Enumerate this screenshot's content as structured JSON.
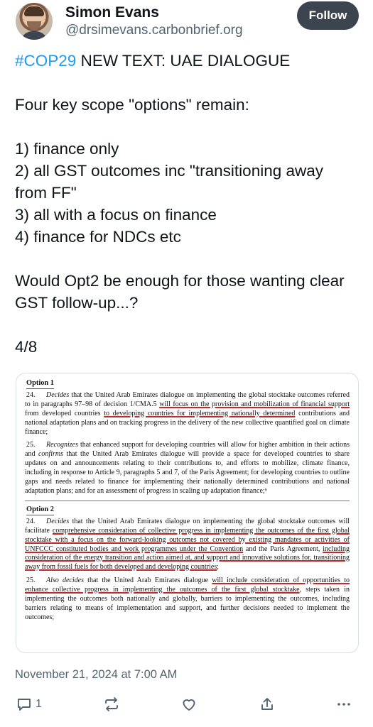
{
  "author": {
    "name": "Simon Evans",
    "handle": "@drsimevans.carbonbrief.org",
    "follow_label": "Follow"
  },
  "post": {
    "hashtag": "#COP29",
    "text_after_hashtag": " NEW TEXT: UAE DIALOGUE\n\nFour key scope \"options\" remain:\n\n1) finance only\n2) all GST outcomes inc \"transitioning away from FF\"\n3) all with a focus on finance\n4) finance for NDCs etc\n\nWould Opt2 be enough for those wanting clear GST follow-up...?\n\n4/8"
  },
  "document": {
    "option1": {
      "heading": "Option 1",
      "p24": {
        "num": "24.",
        "verb": "Decides",
        "pre": " that the United Arab Emirates dialogue on implementing the global stocktake outcomes referred to in paragraphs 97–98 of decision 1/CMA.5 ",
        "underlined": "will focus on the provision and mobilization of financial support",
        "mid": " from developed countries ",
        "underlined2": "to developing countries for implementing nationally determined",
        "post": " contributions and national adaptation plans and on tracking progress in the delivery of the new collective quantified goal on climate finance;"
      },
      "p25": {
        "num": "25.",
        "verb": "Recognizes",
        "pre": " that enhanced support for developing countries will allow for higher ambition in their actions and ",
        "verb2": "confirms",
        "post": " that the United Arab Emirates dialogue will provide a space for developed countries to share updates on and announcements relating to their contributions to, and efforts to mobilize, climate finance, including in response to Article 9, paragraphs 5 and 7, of the Paris Agreement; for developing countries to outline gaps and needs related to finance for implementing their nationally determined contributions and national adaptation plans; and for an assessment of progress in scaling up adaptation finance;⁶"
      }
    },
    "option2": {
      "heading": "Option 2",
      "p24": {
        "num": "24.",
        "verb": "Decides",
        "pre": " that the United Arab Emirates dialogue on implementing the global stocktake outcomes will facilitate ",
        "underlined": "comprehensive consideration of collective progress in implementing the outcomes of the first global stocktake with a focus on the forward-looking outcomes not covered by existing mandates or activities of UNFCCC constituted bodies and work programmes under the Convention",
        "mid": " and the Paris Agreement, ",
        "underlined2": "including consideration of the energy transition and action aimed at, and support and innovative solutions for, transitioning away from fossil fuels for both developed and developing countries",
        "post": ";"
      },
      "p25": {
        "num": "25.",
        "verb": "Also decides",
        "pre": " that the United Arab Emirates dialogue ",
        "underlined": "will include consideration of opportunities to enhance collective progress in implementing the outcomes of the first global stocktake",
        "post": ", steps taken in implementing the outcomes both nationally and globally, barriers to implementing the outcomes, including barriers relating to means of implementation and support, and further decisions needed to implement the outcomes;"
      }
    }
  },
  "timestamp": "November 21, 2024 at 7:00 AM",
  "actions": {
    "reply_count": "1",
    "reply_icon": "reply-icon",
    "repost_icon": "repost-icon",
    "like_icon": "like-icon",
    "share_icon": "share-icon",
    "more_icon": "more-icon"
  },
  "colors": {
    "hashtag": "#1d9bf0",
    "follow_button": "#3c4450",
    "secondary_text": "#536471",
    "underline": "#c62828"
  }
}
